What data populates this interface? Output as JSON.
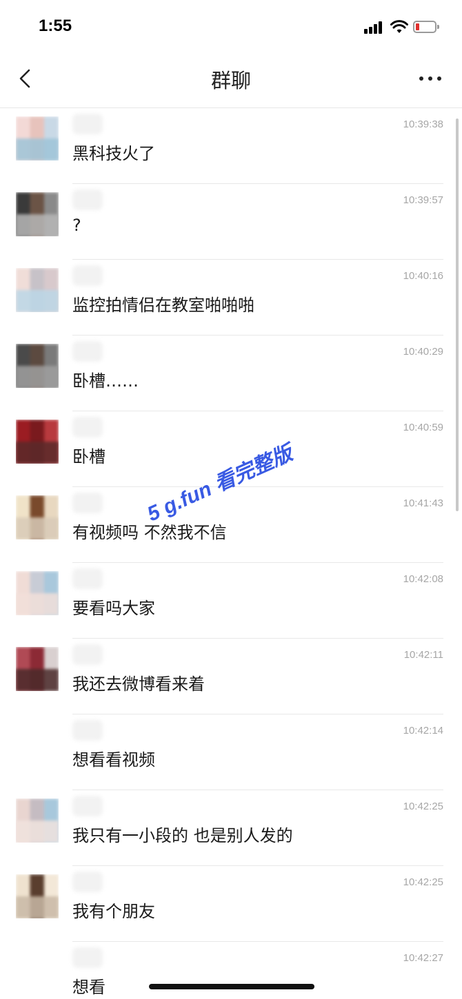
{
  "status_bar": {
    "time": "1:55",
    "battery_color": "#e0312f",
    "icons": [
      "signal-icon",
      "wifi-icon",
      "battery-icon"
    ]
  },
  "nav": {
    "title": "群聊",
    "back_icon": "chevron-left-icon",
    "more_icon": "more-horizontal-icon"
  },
  "messages": [
    {
      "time": "10:39:38",
      "text": "黑科技火了",
      "avatar": true
    },
    {
      "time": "10:39:57",
      "text": "?",
      "avatar": true
    },
    {
      "time": "10:40:16",
      "text": "监控拍情侣在教室啪啪啪",
      "avatar": true
    },
    {
      "time": "10:40:29",
      "text": "卧槽……",
      "avatar": true
    },
    {
      "time": "10:40:59",
      "text": "卧槽",
      "avatar": true
    },
    {
      "time": "10:41:43",
      "text": "有视频吗 不然我不信",
      "avatar": true
    },
    {
      "time": "10:42:08",
      "text": "要看吗大家",
      "avatar": true
    },
    {
      "time": "10:42:11",
      "text": "我还去微博看来着",
      "avatar": true
    },
    {
      "time": "10:42:14",
      "text": "想看看视频",
      "avatar": false
    },
    {
      "time": "10:42:25",
      "text": "我只有一小段的 也是别人发的",
      "avatar": true
    },
    {
      "time": "10:42:25",
      "text": "我有个朋友",
      "avatar": true
    },
    {
      "time": "10:42:27",
      "text": "想看",
      "avatar": false
    }
  ],
  "watermark": "5 g.fun 看完整版"
}
